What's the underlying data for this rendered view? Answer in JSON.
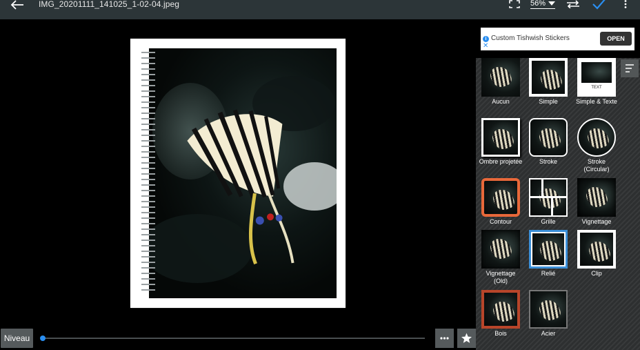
{
  "header": {
    "filename": "IMG_20201111_141025_1-02-04.jpeg",
    "zoom": "56%"
  },
  "ad": {
    "text": "Custom Tishwish Stickers",
    "button": "OPEN"
  },
  "frames": [
    {
      "label": "Aucun",
      "style": "none"
    },
    {
      "label": "Simple",
      "style": "simple"
    },
    {
      "label": "Simple & Texte",
      "style": "simple-text",
      "inner_text": "TEXT"
    },
    {
      "label": "Ombre projetée",
      "style": "shadow"
    },
    {
      "label": "Stroke",
      "style": "stroke"
    },
    {
      "label": "Stroke (Circular)",
      "style": "circular"
    },
    {
      "label": "Contour",
      "style": "contour"
    },
    {
      "label": "Grille",
      "style": "grid"
    },
    {
      "label": "Vignettage",
      "style": "vignette"
    },
    {
      "label": "Vignettage (Old)",
      "style": "vignette-old"
    },
    {
      "label": "Relié",
      "style": "bound"
    },
    {
      "label": "Clip",
      "style": "clip"
    },
    {
      "label": "Bois",
      "style": "wood"
    },
    {
      "label": "Acier",
      "style": "steel"
    }
  ],
  "bottom": {
    "niveau_label": "Niveau",
    "slider_value": 0
  },
  "colors": {
    "accent": "#2a8ef0",
    "contour": "#e8683a",
    "selected": "#3b8fd8",
    "wood": "#b8452a"
  }
}
